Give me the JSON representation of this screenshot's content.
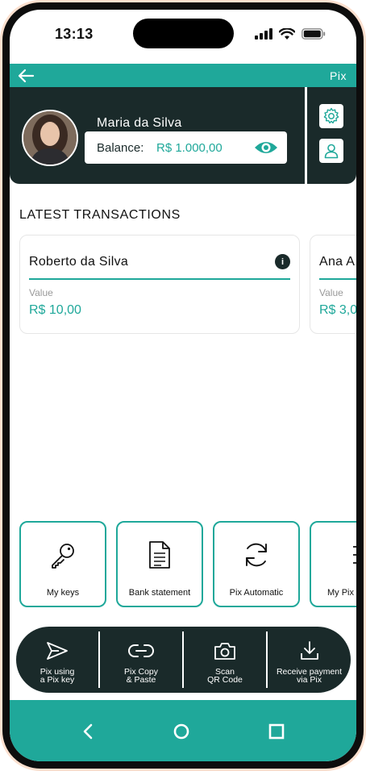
{
  "status_bar": {
    "time": "13:13"
  },
  "header": {
    "title": "Pix"
  },
  "profile": {
    "name": "Maria da Silva",
    "balance_label": "Balance:",
    "balance_value": "R$ 1.000,00"
  },
  "transactions": {
    "section_title": "LATEST TRANSACTIONS",
    "items": [
      {
        "name": "Roberto da Silva",
        "value_label": "Value",
        "value": "R$ 10,00"
      },
      {
        "name": "Ana A",
        "value_label": "Value",
        "value": "R$ 3,0"
      }
    ]
  },
  "tiles": [
    {
      "label": "My keys",
      "icon": "key-icon"
    },
    {
      "label": "Bank statement",
      "icon": "document-icon"
    },
    {
      "label": "Pix Automatic",
      "icon": "refresh-icon"
    },
    {
      "label": "My Pix",
      "icon": "sliders-icon"
    }
  ],
  "quick_actions": [
    {
      "label": "Pix using\na Pix key",
      "icon": "send-icon"
    },
    {
      "label": "Pix Copy\n& Paste",
      "icon": "link-icon"
    },
    {
      "label": "Scan\nQR Code",
      "icon": "camera-icon"
    },
    {
      "label": "Receive payment\nvia Pix",
      "icon": "download-icon"
    }
  ],
  "colors": {
    "accent": "#1fa89a",
    "dark": "#1a2a2a",
    "frame": "#fde0cf"
  }
}
